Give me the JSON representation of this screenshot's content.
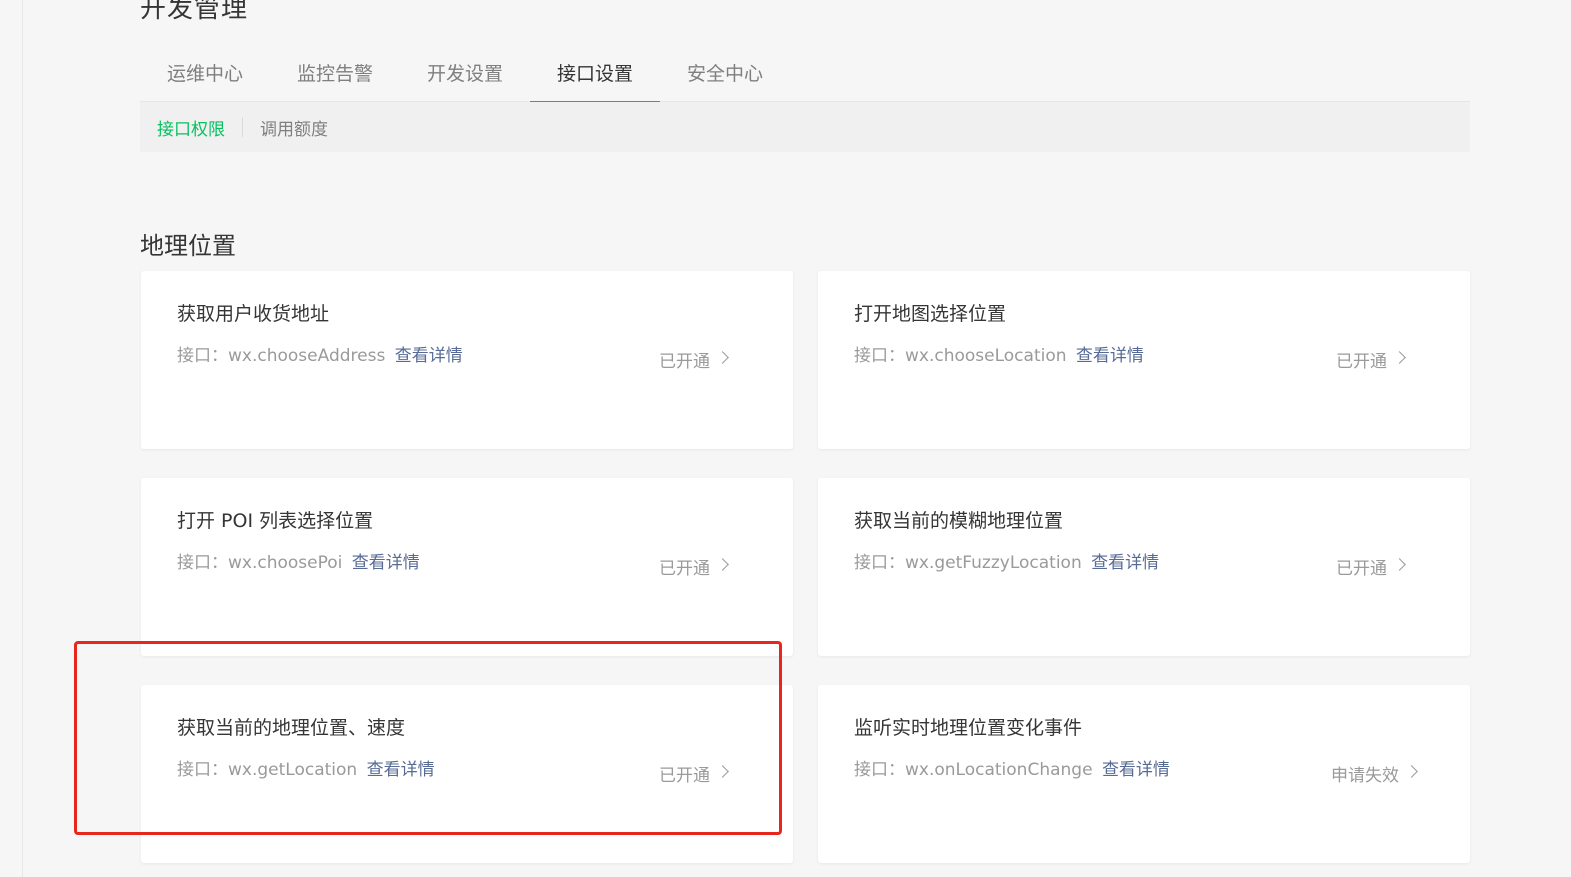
{
  "page": {
    "title": "开发管理"
  },
  "tabs": [
    {
      "label": "运维中心",
      "active": false
    },
    {
      "label": "监控告警",
      "active": false
    },
    {
      "label": "开发设置",
      "active": false
    },
    {
      "label": "接口设置",
      "active": true
    },
    {
      "label": "安全中心",
      "active": false
    }
  ],
  "subtabs": [
    {
      "label": "接口权限",
      "active": true
    },
    {
      "label": "调用额度",
      "active": false
    }
  ],
  "section": {
    "title": "地理位置"
  },
  "cards": [
    {
      "title": "获取用户收货地址",
      "api_label": "接口：",
      "api_name": "wx.chooseAddress",
      "detail_link": "查看详情",
      "status": "已开通"
    },
    {
      "title": "打开地图选择位置",
      "api_label": "接口：",
      "api_name": "wx.chooseLocation",
      "detail_link": "查看详情",
      "status": "已开通"
    },
    {
      "title": "打开 POI 列表选择位置",
      "api_label": "接口：",
      "api_name": "wx.choosePoi",
      "detail_link": "查看详情",
      "status": "已开通"
    },
    {
      "title": "获取当前的模糊地理位置",
      "api_label": "接口：",
      "api_name": "wx.getFuzzyLocation",
      "detail_link": "查看详情",
      "status": "已开通"
    },
    {
      "title": "获取当前的地理位置、速度",
      "api_label": "接口：",
      "api_name": "wx.getLocation",
      "detail_link": "查看详情",
      "status": "已开通"
    },
    {
      "title": "监听实时地理位置变化事件",
      "api_label": "接口：",
      "api_name": "wx.onLocationChange",
      "detail_link": "查看详情",
      "status": "申请失效"
    }
  ],
  "colors": {
    "accent_green": "#07c160",
    "link_blue": "#576b95",
    "highlight_red": "#e8271c"
  }
}
